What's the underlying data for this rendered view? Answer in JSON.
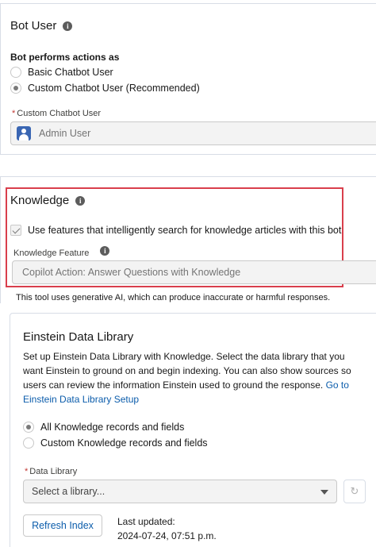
{
  "bot_user": {
    "title": "Bot User",
    "actions_label": "Bot performs actions as",
    "options": [
      {
        "label": "Basic Chatbot User",
        "checked": false
      },
      {
        "label": "Custom Chatbot User (Recommended)",
        "checked": true
      }
    ],
    "custom_user_label": "Custom Chatbot User",
    "custom_user_value": "Admin User",
    "required_mark": "*"
  },
  "knowledge": {
    "title": "Knowledge",
    "checkbox_label": "Use features that intelligently search for knowledge articles with this bot",
    "checkbox_checked": true,
    "feature_label": "Knowledge Feature",
    "feature_value": "Copilot Action: Answer Questions with Knowledge",
    "disclaimer": "This tool uses generative AI, which can produce inaccurate or harmful responses."
  },
  "data_library": {
    "title": "Einstein Data Library",
    "description": "Set up Einstein Data Library with Knowledge. Select the data library that you want Einstein to ground on and begin indexing. You can also show sources so users can review the information Einstein used to ground the response.",
    "link_text": "Go to Einstein Data Library Setup",
    "options": [
      {
        "label": "All Knowledge records and fields",
        "checked": true
      },
      {
        "label": "Custom Knowledge records and fields",
        "checked": false
      }
    ],
    "library_label": "Data Library",
    "library_placeholder": "Select a library...",
    "refresh_button": "Refresh Index",
    "last_updated_label": "Last updated:",
    "last_updated_value": "2024-07-24, 07:51 p.m."
  },
  "icons": {
    "info": "info-icon",
    "user": "user-avatar-icon",
    "caret": "chevron-down-icon",
    "refresh": "refresh-icon"
  },
  "colors": {
    "highlight": "#d93f4c",
    "link": "#0b5cab",
    "avatar": "#3a66b3"
  }
}
